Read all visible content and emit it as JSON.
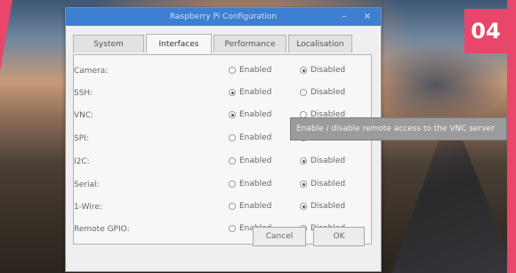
{
  "step_badge": "04",
  "dialog": {
    "title": "Raspberry Pi Configuration",
    "minimize_glyph": "–",
    "close_glyph": "×",
    "tabs": [
      {
        "label": "System",
        "active": false
      },
      {
        "label": "Interfaces",
        "active": true
      },
      {
        "label": "Performance",
        "active": false
      },
      {
        "label": "Localisation",
        "active": false
      }
    ],
    "rows": [
      {
        "label": "Camera:",
        "enabled_label": "Enabled",
        "disabled_label": "Disabled",
        "selected": "disabled"
      },
      {
        "label": "SSH:",
        "enabled_label": "Enabled",
        "disabled_label": "Disabled",
        "selected": "enabled"
      },
      {
        "label": "VNC:",
        "enabled_label": "Enabled",
        "disabled_label": "Disabled",
        "selected": "enabled"
      },
      {
        "label": "SPI:",
        "enabled_label": "Enabled",
        "disabled_label": "Disabled",
        "selected": "disabled"
      },
      {
        "label": "I2C:",
        "enabled_label": "Enabled",
        "disabled_label": "Disabled",
        "selected": "disabled"
      },
      {
        "label": "Serial:",
        "enabled_label": "Enabled",
        "disabled_label": "Disabled",
        "selected": "disabled"
      },
      {
        "label": "1-Wire:",
        "enabled_label": "Enabled",
        "disabled_label": "Disabled",
        "selected": "disabled"
      },
      {
        "label": "Remote GPIO:",
        "enabled_label": "Enabled",
        "disabled_label": "Disabled",
        "selected": "disabled"
      }
    ],
    "tooltip": "Enable / disable remote access to the VNC server",
    "cancel_label": "Cancel",
    "ok_label": "OK"
  },
  "colors": {
    "accent_pink": "#e8466b",
    "titlebar_blue": "#3d7fd0"
  }
}
